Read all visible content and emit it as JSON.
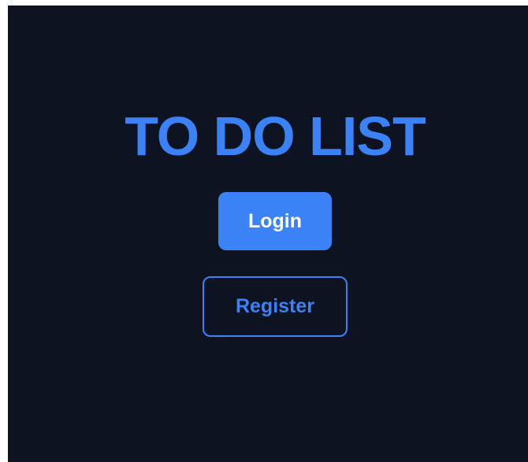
{
  "app": {
    "title": "TO DO LIST"
  },
  "actions": {
    "login_label": "Login",
    "register_label": "Register"
  },
  "colors": {
    "background": "#0e1322",
    "accent": "#3b82f6",
    "button_text": "#ffffff"
  }
}
